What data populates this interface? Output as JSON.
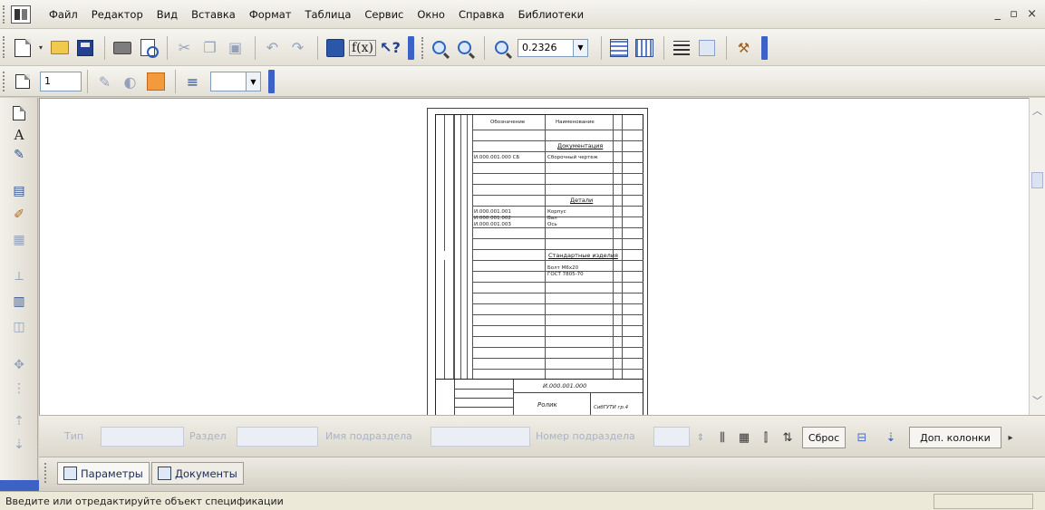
{
  "menu": {
    "items": [
      "Файл",
      "Редактор",
      "Вид",
      "Вставка",
      "Формат",
      "Таблица",
      "Сервис",
      "Окно",
      "Справка",
      "Библиотеки"
    ],
    "window_controls": "_ ▫ ×"
  },
  "toolbar": {
    "zoom_value": "0.2326",
    "icons": [
      "new-document-icon",
      "open-folder-icon",
      "save-icon",
      "print-icon",
      "preview-icon",
      "cut-icon",
      "copy-icon",
      "paste-icon",
      "undo-icon",
      "redo-icon",
      "calculator-icon",
      "function-icon",
      "help-pointer-icon",
      "zoom-in-icon",
      "zoom-out-icon",
      "zoom-scale-icon",
      "grid-icon",
      "layers-icon",
      "lines-icon",
      "panel-icon",
      "wand-icon"
    ]
  },
  "toolbar2": {
    "page_number": "1",
    "icons": [
      "document-view-icon",
      "pen-icon",
      "circle-icon",
      "orange-square-icon",
      "align-icon"
    ]
  },
  "left_tools": {
    "icons": [
      "sheet-icon",
      "text-A-icon",
      "pen-icon",
      "object-icon",
      "brush-icon",
      "table-icon",
      "arrow-icon",
      "spec-icon",
      "insert-icon",
      "move-icon",
      "dot-icon",
      "up-icon",
      "down-icon"
    ]
  },
  "spec_panel": {
    "type_label": "Тип",
    "section_label": "Раздел",
    "subsection_name_label": "Имя подраздела",
    "subsection_number_label": "Номер подраздела",
    "reset_button": "Сброс",
    "extra_columns_button": "Доп. колонки"
  },
  "tabs": [
    {
      "label": "Параметры"
    },
    {
      "label": "Документы"
    }
  ],
  "status": {
    "text": "Введите или отредактируйте объект спецификации"
  },
  "sheet": {
    "header_col1": "Обозначение",
    "header_col2": "Наименование",
    "section_assembly": "Документация",
    "section_parts": "Детали",
    "section_std": "Стандартные изделия",
    "assembly_designation": "И.000.001.000 СБ",
    "assembly_name": "Сборочный чертеж",
    "part1_designation": "И.000.001.001",
    "part2_designation": "И.000.001.002",
    "part3_designation": "И.000.001.003",
    "part1_name": "Корпус",
    "part2_name": "Вал",
    "part3_name": "Ось",
    "std_item": "Болт М6х20",
    "std_item2": "ГОСТ 7805-70",
    "stamp_designation": "И.000.001.000",
    "stamp_name": "Ролик",
    "stamp_code": "СибГУТИ гр.4"
  }
}
